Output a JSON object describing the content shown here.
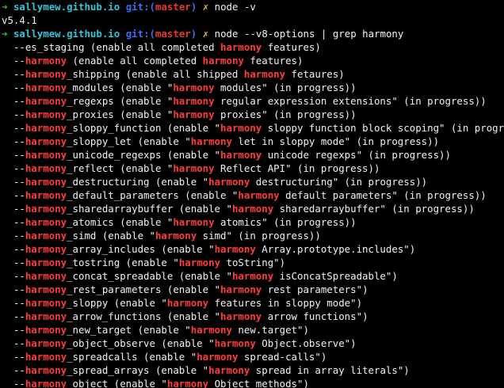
{
  "colors": {
    "background": "#000000",
    "text": "#f2f2f2",
    "prompt_arrow": "#2ec52e",
    "hostname": "#33c4d6",
    "git_label": "#3a6ff0",
    "branch": "#e8372f",
    "dirty_marker": "#d8c43a",
    "grep_match": "#ff3b3b"
  },
  "prompt": {
    "arrow": "➜",
    "host": "sallymew.github.io",
    "git_prefix": "git:(",
    "branch": "master",
    "git_suffix": ")",
    "dirty": "✗"
  },
  "highlight_term": "harmony",
  "lines": [
    {
      "type": "prompt",
      "command": "node -v"
    },
    {
      "type": "output",
      "text": "v5.4.1"
    },
    {
      "type": "prompt",
      "command": "node --v8-options | grep harmony"
    },
    {
      "type": "output",
      "text": "  --es_staging (enable all completed harmony features)"
    },
    {
      "type": "output",
      "text": "  --harmony (enable all completed harmony features)"
    },
    {
      "type": "output",
      "text": "  --harmony_shipping (enable all shipped harmony fetaures)"
    },
    {
      "type": "output",
      "text": "  --harmony_modules (enable \"harmony modules\" (in progress))"
    },
    {
      "type": "output",
      "text": "  --harmony_regexps (enable \"harmony regular expression extensions\" (in progress))"
    },
    {
      "type": "output",
      "text": "  --harmony_proxies (enable \"harmony proxies\" (in progress))"
    },
    {
      "type": "output",
      "text": "  --harmony_sloppy_function (enable \"harmony sloppy function block scoping\" (in progress))"
    },
    {
      "type": "output",
      "text": "  --harmony_sloppy_let (enable \"harmony let in sloppy mode\" (in progress))"
    },
    {
      "type": "output",
      "text": "  --harmony_unicode_regexps (enable \"harmony unicode regexps\" (in progress))"
    },
    {
      "type": "output",
      "text": "  --harmony_reflect (enable \"harmony Reflect API\" (in progress))"
    },
    {
      "type": "output",
      "text": "  --harmony_destructuring (enable \"harmony destructuring\" (in progress))"
    },
    {
      "type": "output",
      "text": "  --harmony_default_parameters (enable \"harmony default parameters\" (in progress))"
    },
    {
      "type": "output",
      "text": "  --harmony_sharedarraybuffer (enable \"harmony sharedarraybuffer\" (in progress))"
    },
    {
      "type": "output",
      "text": "  --harmony_atomics (enable \"harmony atomics\" (in progress))"
    },
    {
      "type": "output",
      "text": "  --harmony_simd (enable \"harmony simd\" (in progress))"
    },
    {
      "type": "output",
      "text": "  --harmony_array_includes (enable \"harmony Array.prototype.includes\")"
    },
    {
      "type": "output",
      "text": "  --harmony_tostring (enable \"harmony toString\")"
    },
    {
      "type": "output",
      "text": "  --harmony_concat_spreadable (enable \"harmony isConcatSpreadable\")"
    },
    {
      "type": "output",
      "text": "  --harmony_rest_parameters (enable \"harmony rest parameters\")"
    },
    {
      "type": "output",
      "text": "  --harmony_sloppy (enable \"harmony features in sloppy mode\")"
    },
    {
      "type": "output",
      "text": "  --harmony_arrow_functions (enable \"harmony arrow functions\")"
    },
    {
      "type": "output",
      "text": "  --harmony_new_target (enable \"harmony new.target\")"
    },
    {
      "type": "output",
      "text": "  --harmony_object_observe (enable \"harmony Object.observe\")"
    },
    {
      "type": "output",
      "text": "  --harmony_spreadcalls (enable \"harmony spread-calls\")"
    },
    {
      "type": "output",
      "text": "  --harmony_spread_arrays (enable \"harmony spread in array literals\")"
    },
    {
      "type": "output",
      "text": "  --harmony_object (enable \"harmony Object methods\")"
    }
  ]
}
